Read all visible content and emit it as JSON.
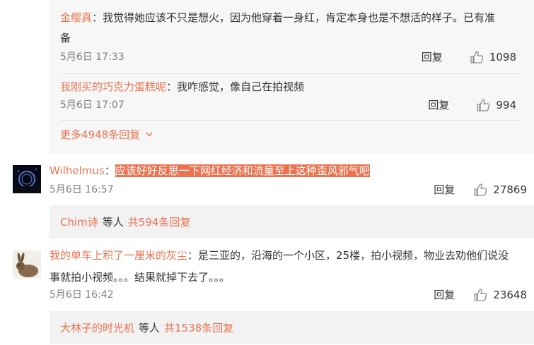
{
  "colors": {
    "accent": "#eb7350",
    "nested_bg": "#f7f7f7",
    "summary_bg": "#f2f2f2",
    "text": "#333333",
    "muted": "#808080"
  },
  "nested_replies": [
    {
      "user": "金缨真",
      "text_line1": "：我觉得她应该不只是想火，因为他穿着一身红，肯定本身也是不想活的样子。已有准",
      "text_line2": "备",
      "time": "5月6日 17:33",
      "reply_label": "回复",
      "likes": "1098"
    },
    {
      "user": "我刚买的巧克力蛋糕呢",
      "text_line1": "：我咋感觉，像自己在拍视频",
      "time": "5月6日 17:07",
      "reply_label": "回复",
      "likes": "994"
    }
  ],
  "more_replies_label": "更多4948条回复",
  "comments": [
    {
      "user": "Wilhelmus",
      "separator": "：",
      "text": "应该好好反思一下网红经济和流量至上这种歪风邪气吧",
      "time": "5月6日 16:57",
      "reply_label": "回复",
      "likes": "27869",
      "summary_name": "Chim诗",
      "summary_mid": "等人",
      "summary_count": "共594条回复",
      "avatar_icon": "night-sky-avatar"
    },
    {
      "user": "我的单车上积了一厘米的灰尘",
      "text_line1": "：是三亚的，沿海的一个小区，25楼，拍小视频，物业去劝他们说没",
      "text_line2": "事就拍小视频。。。结果就掉下去了。。。",
      "time": "5月6日 16:42",
      "reply_label": "回复",
      "likes": "23648",
      "summary_name": "大林子的时光机",
      "summary_mid": "等人",
      "summary_count": "共1538条回复",
      "avatar_icon": "rabbit-avatar"
    }
  ]
}
